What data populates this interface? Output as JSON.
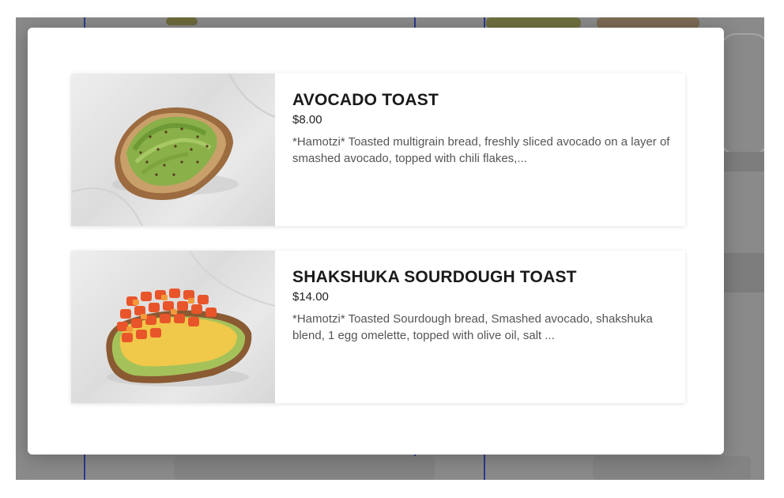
{
  "menu_items": [
    {
      "name": "AVOCADO TOAST",
      "price": "$8.00",
      "description": "*Hamotzi* Toasted multigrain bread, freshly sliced avocado on a layer of smashed avocado, topped with chili flakes,..."
    },
    {
      "name": "SHAKSHUKA SOURDOUGH TOAST",
      "price": "$14.00",
      "description": "*Hamotzi* Toasted Sourdough bread, Smashed avocado, shakshuka blend, 1 egg omelette, topped with olive oil, salt ..."
    }
  ],
  "colors": {
    "overlay": "#8a8a8a",
    "modal_bg": "#ffffff",
    "title_text": "#1a1a1a",
    "description_text": "#555555"
  }
}
